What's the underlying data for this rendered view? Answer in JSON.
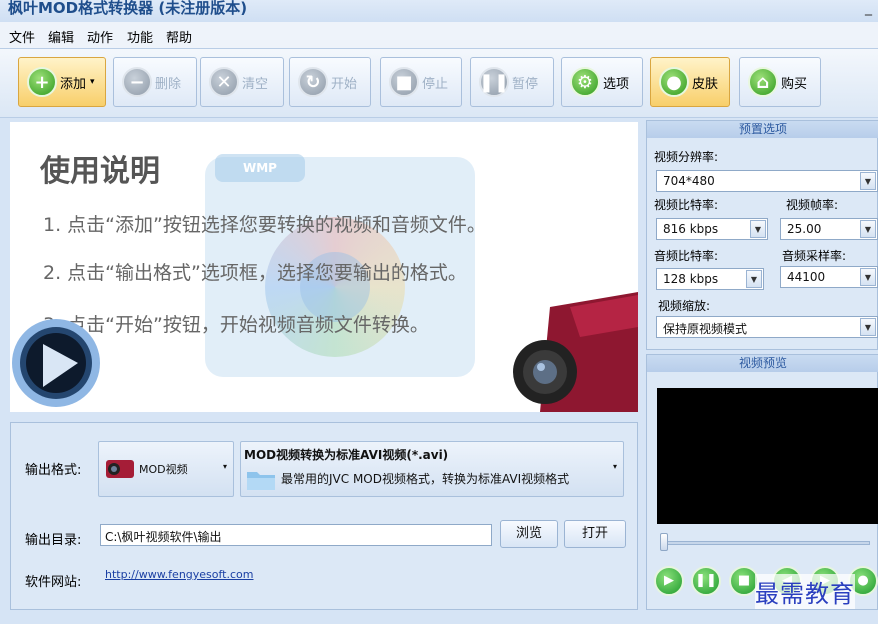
{
  "window": {
    "title": "枫叶MOD格式转换器 (未注册版本)",
    "minimize": "_"
  },
  "menu": [
    "文件",
    "编辑",
    "动作",
    "功能",
    "帮助"
  ],
  "toolbar": {
    "add": "添加",
    "add_dropdown": "▾",
    "delete": "删除",
    "clear": "清空",
    "start": "开始",
    "stop": "停止",
    "pause": "暂停",
    "options": "选项",
    "skin": "皮肤",
    "buy": "购买"
  },
  "usage": {
    "title": "使用说明",
    "steps": [
      "1. 点击“添加”按钮选择您要转换的视频和音频文件。",
      "2. 点击“输出格式”选项框，选择您要输出的格式。",
      "3. 点击“开始”按钮，开始视频音频文件转换。"
    ],
    "wmp_label": "WMP"
  },
  "output": {
    "format_label": "输出格式:",
    "format_value": "MOD视频",
    "format_title": "MOD视频转换为标准AVI视频(*.avi)",
    "format_desc": "最常用的JVC MOD视频格式，转换为标准AVI视频格式",
    "dir_label": "输出目录:",
    "dir_value": "C:\\枫叶视频软件\\输出",
    "browse": "浏览",
    "open": "打开",
    "site_label": "软件网站:",
    "site_url": "http://www.fengyesoft.com"
  },
  "presets": {
    "header": "预置选项",
    "resolution_label": "视频分辨率:",
    "resolution": "704*480",
    "vbitrate_label": "视频比特率:",
    "vbitrate": "816 kbps",
    "fps_label": "视频帧率:",
    "fps": "25.00",
    "abitrate_label": "音频比特率:",
    "abitrate": "128 kbps",
    "samplerate_label": "音频采样率:",
    "samplerate": "44100",
    "scale_label": "视频缩放:",
    "scale": "保持原视频模式"
  },
  "preview": {
    "header": "视频预览"
  },
  "watermark": "最需教育",
  "colors": {
    "accent": "#2e9a1c",
    "panel": "#dce8f6",
    "title": "#1f4e8c"
  }
}
